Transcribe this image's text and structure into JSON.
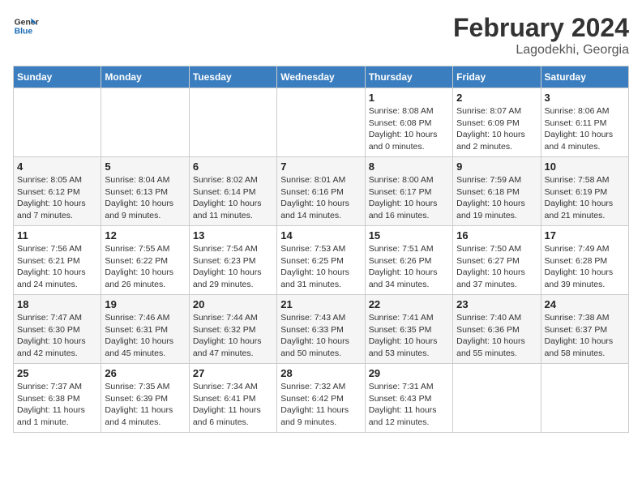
{
  "header": {
    "logo_general": "General",
    "logo_blue": "Blue",
    "month_year": "February 2024",
    "location": "Lagodekhi, Georgia"
  },
  "days_of_week": [
    "Sunday",
    "Monday",
    "Tuesday",
    "Wednesday",
    "Thursday",
    "Friday",
    "Saturday"
  ],
  "weeks": [
    [
      {
        "day": "",
        "sunrise": "",
        "sunset": "",
        "daylight": ""
      },
      {
        "day": "",
        "sunrise": "",
        "sunset": "",
        "daylight": ""
      },
      {
        "day": "",
        "sunrise": "",
        "sunset": "",
        "daylight": ""
      },
      {
        "day": "",
        "sunrise": "",
        "sunset": "",
        "daylight": ""
      },
      {
        "day": "1",
        "sunrise": "Sunrise: 8:08 AM",
        "sunset": "Sunset: 6:08 PM",
        "daylight": "Daylight: 10 hours and 0 minutes."
      },
      {
        "day": "2",
        "sunrise": "Sunrise: 8:07 AM",
        "sunset": "Sunset: 6:09 PM",
        "daylight": "Daylight: 10 hours and 2 minutes."
      },
      {
        "day": "3",
        "sunrise": "Sunrise: 8:06 AM",
        "sunset": "Sunset: 6:11 PM",
        "daylight": "Daylight: 10 hours and 4 minutes."
      }
    ],
    [
      {
        "day": "4",
        "sunrise": "Sunrise: 8:05 AM",
        "sunset": "Sunset: 6:12 PM",
        "daylight": "Daylight: 10 hours and 7 minutes."
      },
      {
        "day": "5",
        "sunrise": "Sunrise: 8:04 AM",
        "sunset": "Sunset: 6:13 PM",
        "daylight": "Daylight: 10 hours and 9 minutes."
      },
      {
        "day": "6",
        "sunrise": "Sunrise: 8:02 AM",
        "sunset": "Sunset: 6:14 PM",
        "daylight": "Daylight: 10 hours and 11 minutes."
      },
      {
        "day": "7",
        "sunrise": "Sunrise: 8:01 AM",
        "sunset": "Sunset: 6:16 PM",
        "daylight": "Daylight: 10 hours and 14 minutes."
      },
      {
        "day": "8",
        "sunrise": "Sunrise: 8:00 AM",
        "sunset": "Sunset: 6:17 PM",
        "daylight": "Daylight: 10 hours and 16 minutes."
      },
      {
        "day": "9",
        "sunrise": "Sunrise: 7:59 AM",
        "sunset": "Sunset: 6:18 PM",
        "daylight": "Daylight: 10 hours and 19 minutes."
      },
      {
        "day": "10",
        "sunrise": "Sunrise: 7:58 AM",
        "sunset": "Sunset: 6:19 PM",
        "daylight": "Daylight: 10 hours and 21 minutes."
      }
    ],
    [
      {
        "day": "11",
        "sunrise": "Sunrise: 7:56 AM",
        "sunset": "Sunset: 6:21 PM",
        "daylight": "Daylight: 10 hours and 24 minutes."
      },
      {
        "day": "12",
        "sunrise": "Sunrise: 7:55 AM",
        "sunset": "Sunset: 6:22 PM",
        "daylight": "Daylight: 10 hours and 26 minutes."
      },
      {
        "day": "13",
        "sunrise": "Sunrise: 7:54 AM",
        "sunset": "Sunset: 6:23 PM",
        "daylight": "Daylight: 10 hours and 29 minutes."
      },
      {
        "day": "14",
        "sunrise": "Sunrise: 7:53 AM",
        "sunset": "Sunset: 6:25 PM",
        "daylight": "Daylight: 10 hours and 31 minutes."
      },
      {
        "day": "15",
        "sunrise": "Sunrise: 7:51 AM",
        "sunset": "Sunset: 6:26 PM",
        "daylight": "Daylight: 10 hours and 34 minutes."
      },
      {
        "day": "16",
        "sunrise": "Sunrise: 7:50 AM",
        "sunset": "Sunset: 6:27 PM",
        "daylight": "Daylight: 10 hours and 37 minutes."
      },
      {
        "day": "17",
        "sunrise": "Sunrise: 7:49 AM",
        "sunset": "Sunset: 6:28 PM",
        "daylight": "Daylight: 10 hours and 39 minutes."
      }
    ],
    [
      {
        "day": "18",
        "sunrise": "Sunrise: 7:47 AM",
        "sunset": "Sunset: 6:30 PM",
        "daylight": "Daylight: 10 hours and 42 minutes."
      },
      {
        "day": "19",
        "sunrise": "Sunrise: 7:46 AM",
        "sunset": "Sunset: 6:31 PM",
        "daylight": "Daylight: 10 hours and 45 minutes."
      },
      {
        "day": "20",
        "sunrise": "Sunrise: 7:44 AM",
        "sunset": "Sunset: 6:32 PM",
        "daylight": "Daylight: 10 hours and 47 minutes."
      },
      {
        "day": "21",
        "sunrise": "Sunrise: 7:43 AM",
        "sunset": "Sunset: 6:33 PM",
        "daylight": "Daylight: 10 hours and 50 minutes."
      },
      {
        "day": "22",
        "sunrise": "Sunrise: 7:41 AM",
        "sunset": "Sunset: 6:35 PM",
        "daylight": "Daylight: 10 hours and 53 minutes."
      },
      {
        "day": "23",
        "sunrise": "Sunrise: 7:40 AM",
        "sunset": "Sunset: 6:36 PM",
        "daylight": "Daylight: 10 hours and 55 minutes."
      },
      {
        "day": "24",
        "sunrise": "Sunrise: 7:38 AM",
        "sunset": "Sunset: 6:37 PM",
        "daylight": "Daylight: 10 hours and 58 minutes."
      }
    ],
    [
      {
        "day": "25",
        "sunrise": "Sunrise: 7:37 AM",
        "sunset": "Sunset: 6:38 PM",
        "daylight": "Daylight: 11 hours and 1 minute."
      },
      {
        "day": "26",
        "sunrise": "Sunrise: 7:35 AM",
        "sunset": "Sunset: 6:39 PM",
        "daylight": "Daylight: 11 hours and 4 minutes."
      },
      {
        "day": "27",
        "sunrise": "Sunrise: 7:34 AM",
        "sunset": "Sunset: 6:41 PM",
        "daylight": "Daylight: 11 hours and 6 minutes."
      },
      {
        "day": "28",
        "sunrise": "Sunrise: 7:32 AM",
        "sunset": "Sunset: 6:42 PM",
        "daylight": "Daylight: 11 hours and 9 minutes."
      },
      {
        "day": "29",
        "sunrise": "Sunrise: 7:31 AM",
        "sunset": "Sunset: 6:43 PM",
        "daylight": "Daylight: 11 hours and 12 minutes."
      },
      {
        "day": "",
        "sunrise": "",
        "sunset": "",
        "daylight": ""
      },
      {
        "day": "",
        "sunrise": "",
        "sunset": "",
        "daylight": ""
      }
    ]
  ]
}
